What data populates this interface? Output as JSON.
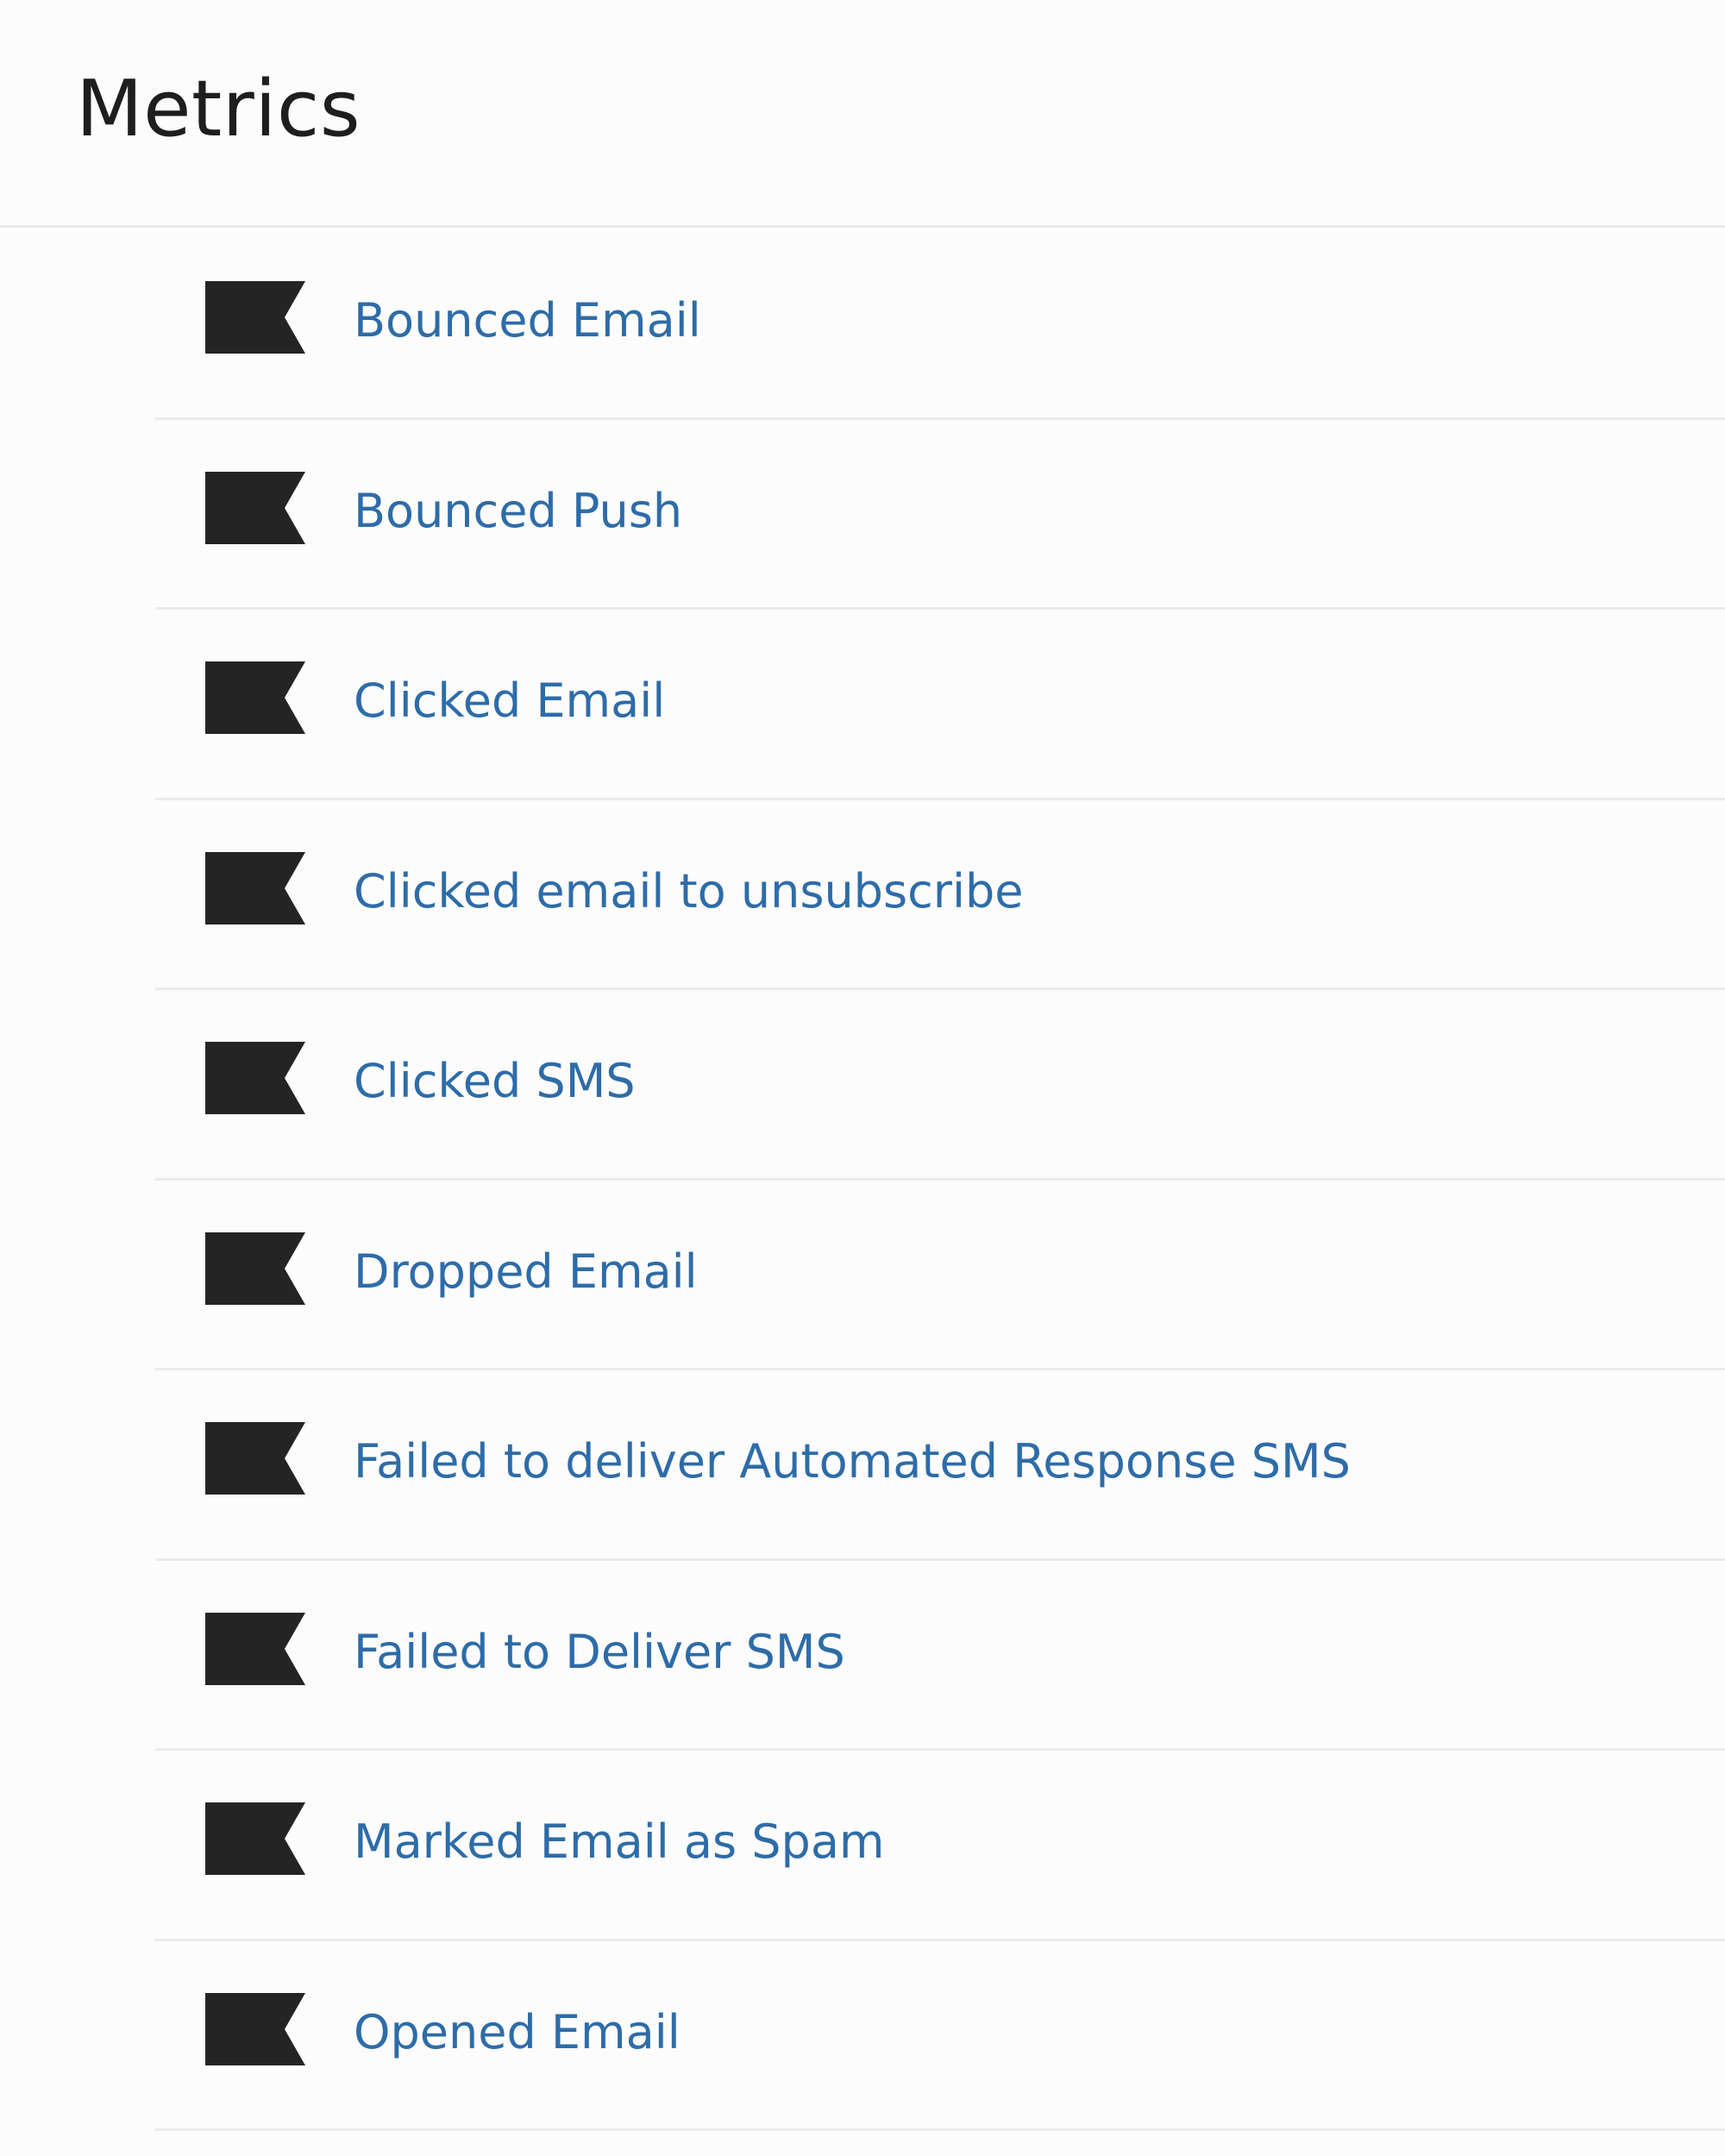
{
  "page": {
    "title": "Metrics"
  },
  "colors": {
    "link": "#2e6ca8",
    "icon": "#242424",
    "divider": "#ebebeb",
    "background": "#fcfcfc"
  },
  "metrics": [
    {
      "label": "Bounced Email",
      "icon": "flag-icon"
    },
    {
      "label": "Bounced Push",
      "icon": "flag-icon"
    },
    {
      "label": "Clicked Email",
      "icon": "flag-icon"
    },
    {
      "label": "Clicked email to unsubscribe",
      "icon": "flag-icon"
    },
    {
      "label": "Clicked SMS",
      "icon": "flag-icon"
    },
    {
      "label": "Dropped Email",
      "icon": "flag-icon"
    },
    {
      "label": "Failed to deliver Automated Response SMS",
      "icon": "flag-icon"
    },
    {
      "label": "Failed to Deliver SMS",
      "icon": "flag-icon"
    },
    {
      "label": "Marked Email as Spam",
      "icon": "flag-icon"
    },
    {
      "label": "Opened Email",
      "icon": "flag-icon"
    }
  ]
}
